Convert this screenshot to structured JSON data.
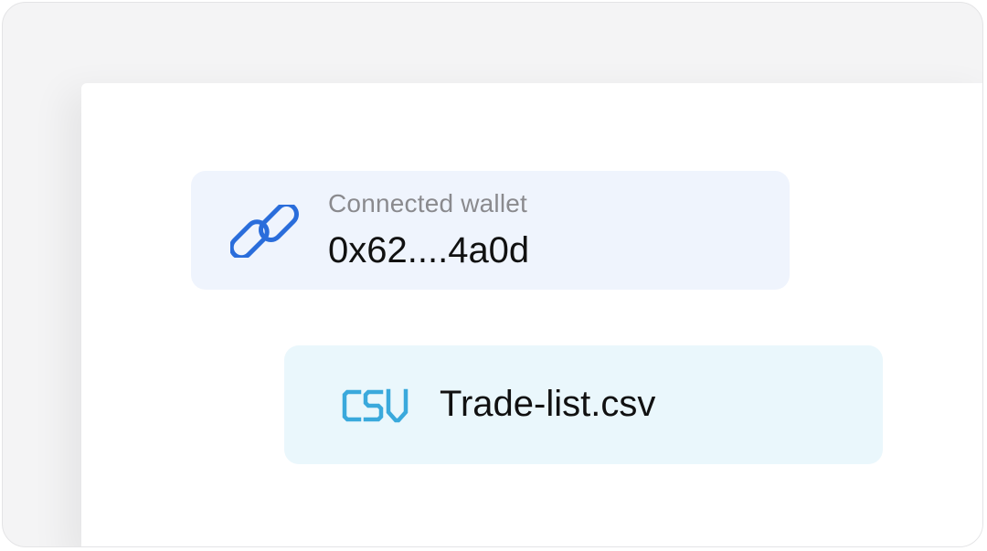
{
  "wallet": {
    "label": "Connected wallet",
    "address": "0x62....4a0d",
    "icon": "link-icon",
    "icon_color": "#2a6ddb",
    "card_color": "#eff4fd"
  },
  "file": {
    "name": "Trade-list.csv",
    "icon": "csv-icon",
    "icon_text": "CSV",
    "icon_color": "#3aa9dc",
    "card_color": "#eaf7fc"
  }
}
